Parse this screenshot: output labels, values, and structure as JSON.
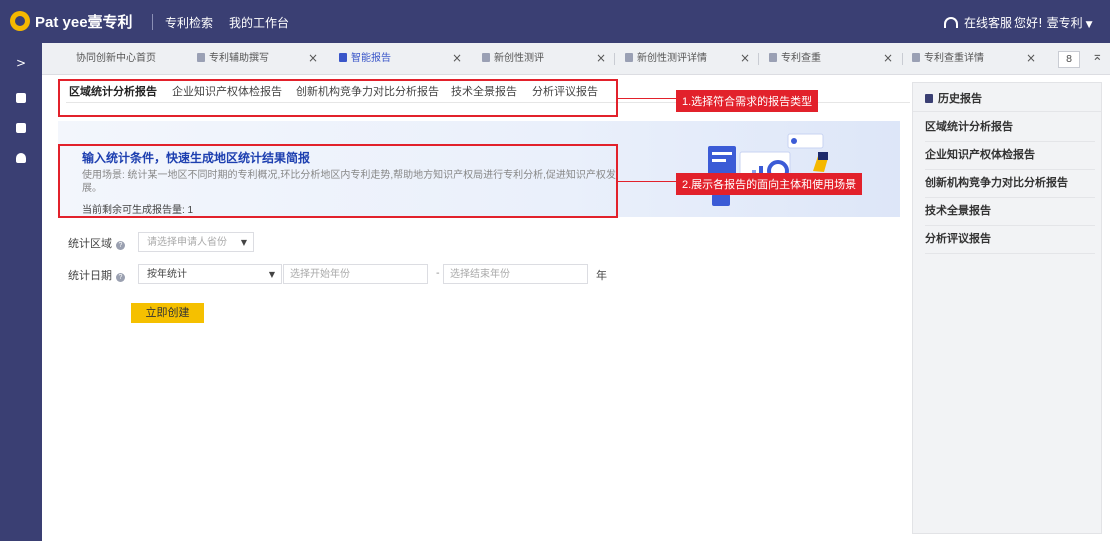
{
  "header": {
    "logo": "Pat yee壹专利",
    "nav": [
      "专利检索",
      "我的工作台"
    ],
    "online_service": "在线客服",
    "greeting": "您好! 壹专利"
  },
  "colors": {
    "brand": "#3a3f73",
    "accent": "#f5c000",
    "highlight": "#e2212b",
    "link": "#1d3fb0"
  },
  "tabs": [
    {
      "label": "协同创新中心首页"
    },
    {
      "label": "专利辅助撰写"
    },
    {
      "label": "智能报告"
    },
    {
      "label": "新创性测评"
    },
    {
      "label": "新创性测评详情"
    },
    {
      "label": "专利查重"
    },
    {
      "label": "专利查重详情"
    }
  ],
  "tab_count": "8",
  "report_tabs": [
    "区域统计分析报告",
    "企业知识产权体检报告",
    "创新机构竞争力对比分析报告",
    "技术全景报告",
    "分析评议报告"
  ],
  "callouts": {
    "tabs_note": "1.选择符合需求的报告类型",
    "banner_note": "2.展示各报告的面向主体和使用场景"
  },
  "banner": {
    "title": "输入统计条件，快速生成地区统计结果简报",
    "description": "使用场景: 统计某一地区不同时期的专利概况,环比分析地区内专利走势,帮助地方知识产权局进行专利分析,促进知识产权发展。",
    "remaining": "当前剩余可生成报告量: 1"
  },
  "form": {
    "region_label": "统计区域",
    "region_placeholder": "请选择申请人省份",
    "date_label": "统计日期",
    "date_mode": "按年统计",
    "start_placeholder": "选择开始年份",
    "end_placeholder": "选择结束年份",
    "dash": "-",
    "year_unit": "年",
    "submit": "立即创建"
  },
  "history": {
    "title": "历史报告",
    "items": [
      "区域统计分析报告",
      "企业知识产权体检报告",
      "创新机构竞争力对比分析报告",
      "技术全景报告",
      "分析评议报告"
    ]
  }
}
